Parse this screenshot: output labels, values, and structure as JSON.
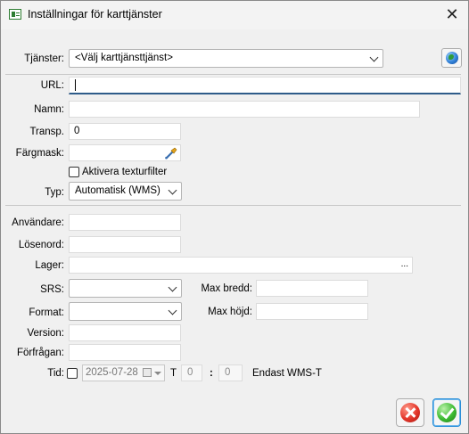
{
  "window": {
    "title": "Inställningar för karttjänster",
    "close_icon": "close-icon"
  },
  "services": {
    "label": "Tjänster:",
    "selected": "<Välj karttjänsttjänst>"
  },
  "url": {
    "label": "URL:",
    "value": ""
  },
  "name": {
    "label": "Namn:",
    "value": ""
  },
  "transp": {
    "label": "Transp.",
    "value": "0"
  },
  "colormask": {
    "label": "Färgmask:",
    "value": ""
  },
  "texture_filter": {
    "label": "Aktivera texturfilter",
    "checked": false
  },
  "type": {
    "label": "Typ:",
    "selected": "Automatisk (WMS)"
  },
  "user": {
    "label": "Användare:",
    "value": ""
  },
  "password": {
    "label": "Lösenord:",
    "value": ""
  },
  "layers": {
    "label": "Lager:",
    "value": "",
    "browse_label": "..."
  },
  "srs": {
    "label": "SRS:",
    "selected": ""
  },
  "max_width": {
    "label": "Max bredd:",
    "value": ""
  },
  "format": {
    "label": "Format:",
    "selected": ""
  },
  "max_height": {
    "label": "Max höjd:",
    "value": ""
  },
  "version": {
    "label": "Version:",
    "value": ""
  },
  "request": {
    "label": "Förfrågan:",
    "value": ""
  },
  "time": {
    "label": "Tid:",
    "checked": false,
    "date": "2025-07-28",
    "t_label": "T",
    "hour": "0",
    "colon": ":",
    "minute": "0",
    "note": "Endast WMS-T"
  },
  "buttons": {
    "cancel_icon": "cancel-icon",
    "ok_icon": "ok-icon"
  },
  "colors": {
    "focus_underline": "#2f5c8a",
    "ok_border": "#2a8fd8"
  }
}
